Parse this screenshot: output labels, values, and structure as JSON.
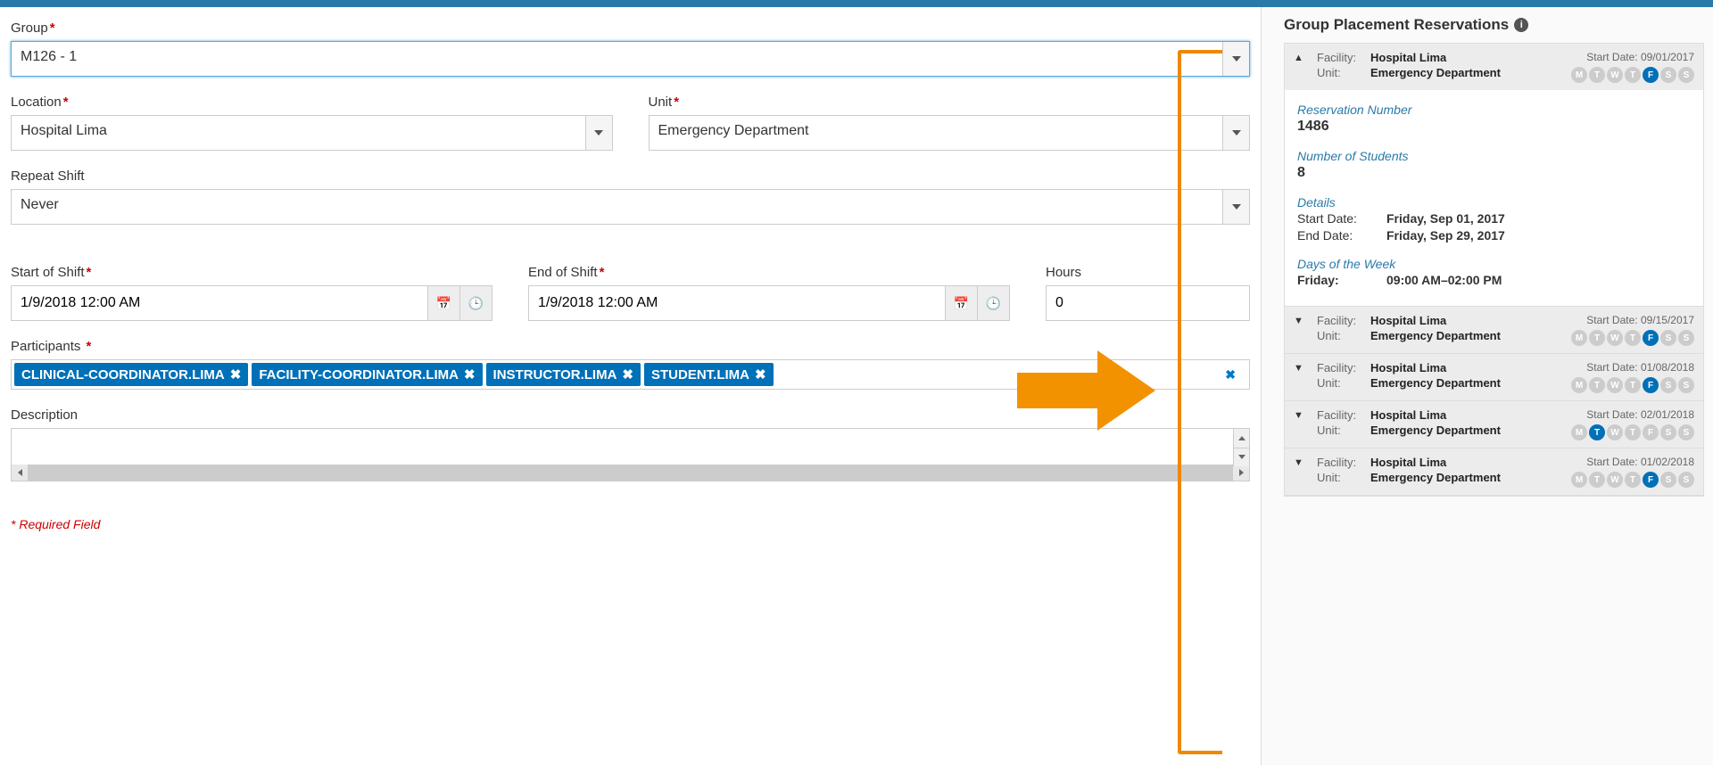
{
  "form": {
    "group_label": "Group",
    "group_value": "M126 - 1",
    "location_label": "Location",
    "location_value": "Hospital Lima",
    "unit_label": "Unit",
    "unit_value": "Emergency Department",
    "repeat_label": "Repeat Shift",
    "repeat_value": "Never",
    "start_label": "Start of Shift",
    "start_value": "1/9/2018 12:00 AM",
    "end_label": "End of Shift",
    "end_value": "1/9/2018 12:00 AM",
    "hours_label": "Hours",
    "hours_value": "0",
    "participants_label": "Participants",
    "participants": [
      "CLINICAL-COORDINATOR.LIMA",
      "FACILITY-COORDINATOR.LIMA",
      "INSTRUCTOR.LIMA",
      "STUDENT.LIMA"
    ],
    "description_label": "Description",
    "required_note": "* Required Field"
  },
  "side": {
    "title": "Group Placement Reservations",
    "labels": {
      "facility": "Facility:",
      "unit": "Unit:",
      "start_date": "Start Date:",
      "reservation_number": "Reservation Number",
      "number_of_students": "Number of Students",
      "details": "Details",
      "start_date_full": "Start Date:",
      "end_date_full": "End Date:",
      "days_of_week": "Days of the Week"
    },
    "day_letters": [
      "M",
      "T",
      "W",
      "T",
      "F",
      "S",
      "S"
    ],
    "items": [
      {
        "expanded": true,
        "facility": "Hospital Lima",
        "unit": "Emergency Department",
        "start_date": "09/01/2017",
        "active_days": [
          false,
          false,
          false,
          false,
          true,
          false,
          false
        ],
        "reservation_number": "1486",
        "number_of_students": "8",
        "start_date_full": "Friday, Sep 01, 2017",
        "end_date_full": "Friday, Sep 29, 2017",
        "schedule_day": "Friday:",
        "schedule_time": "09:00 AM–02:00 PM"
      },
      {
        "expanded": false,
        "facility": "Hospital Lima",
        "unit": "Emergency Department",
        "start_date": "09/15/2017",
        "active_days": [
          false,
          false,
          false,
          false,
          true,
          false,
          false
        ]
      },
      {
        "expanded": false,
        "facility": "Hospital Lima",
        "unit": "Emergency Department",
        "start_date": "01/08/2018",
        "active_days": [
          false,
          false,
          false,
          false,
          true,
          false,
          false
        ]
      },
      {
        "expanded": false,
        "facility": "Hospital Lima",
        "unit": "Emergency Department",
        "start_date": "02/01/2018",
        "active_days": [
          false,
          true,
          false,
          false,
          false,
          false,
          false
        ]
      },
      {
        "expanded": false,
        "facility": "Hospital Lima",
        "unit": "Emergency Department",
        "start_date": "01/02/2018",
        "active_days": [
          false,
          false,
          false,
          false,
          true,
          false,
          false
        ]
      }
    ]
  }
}
